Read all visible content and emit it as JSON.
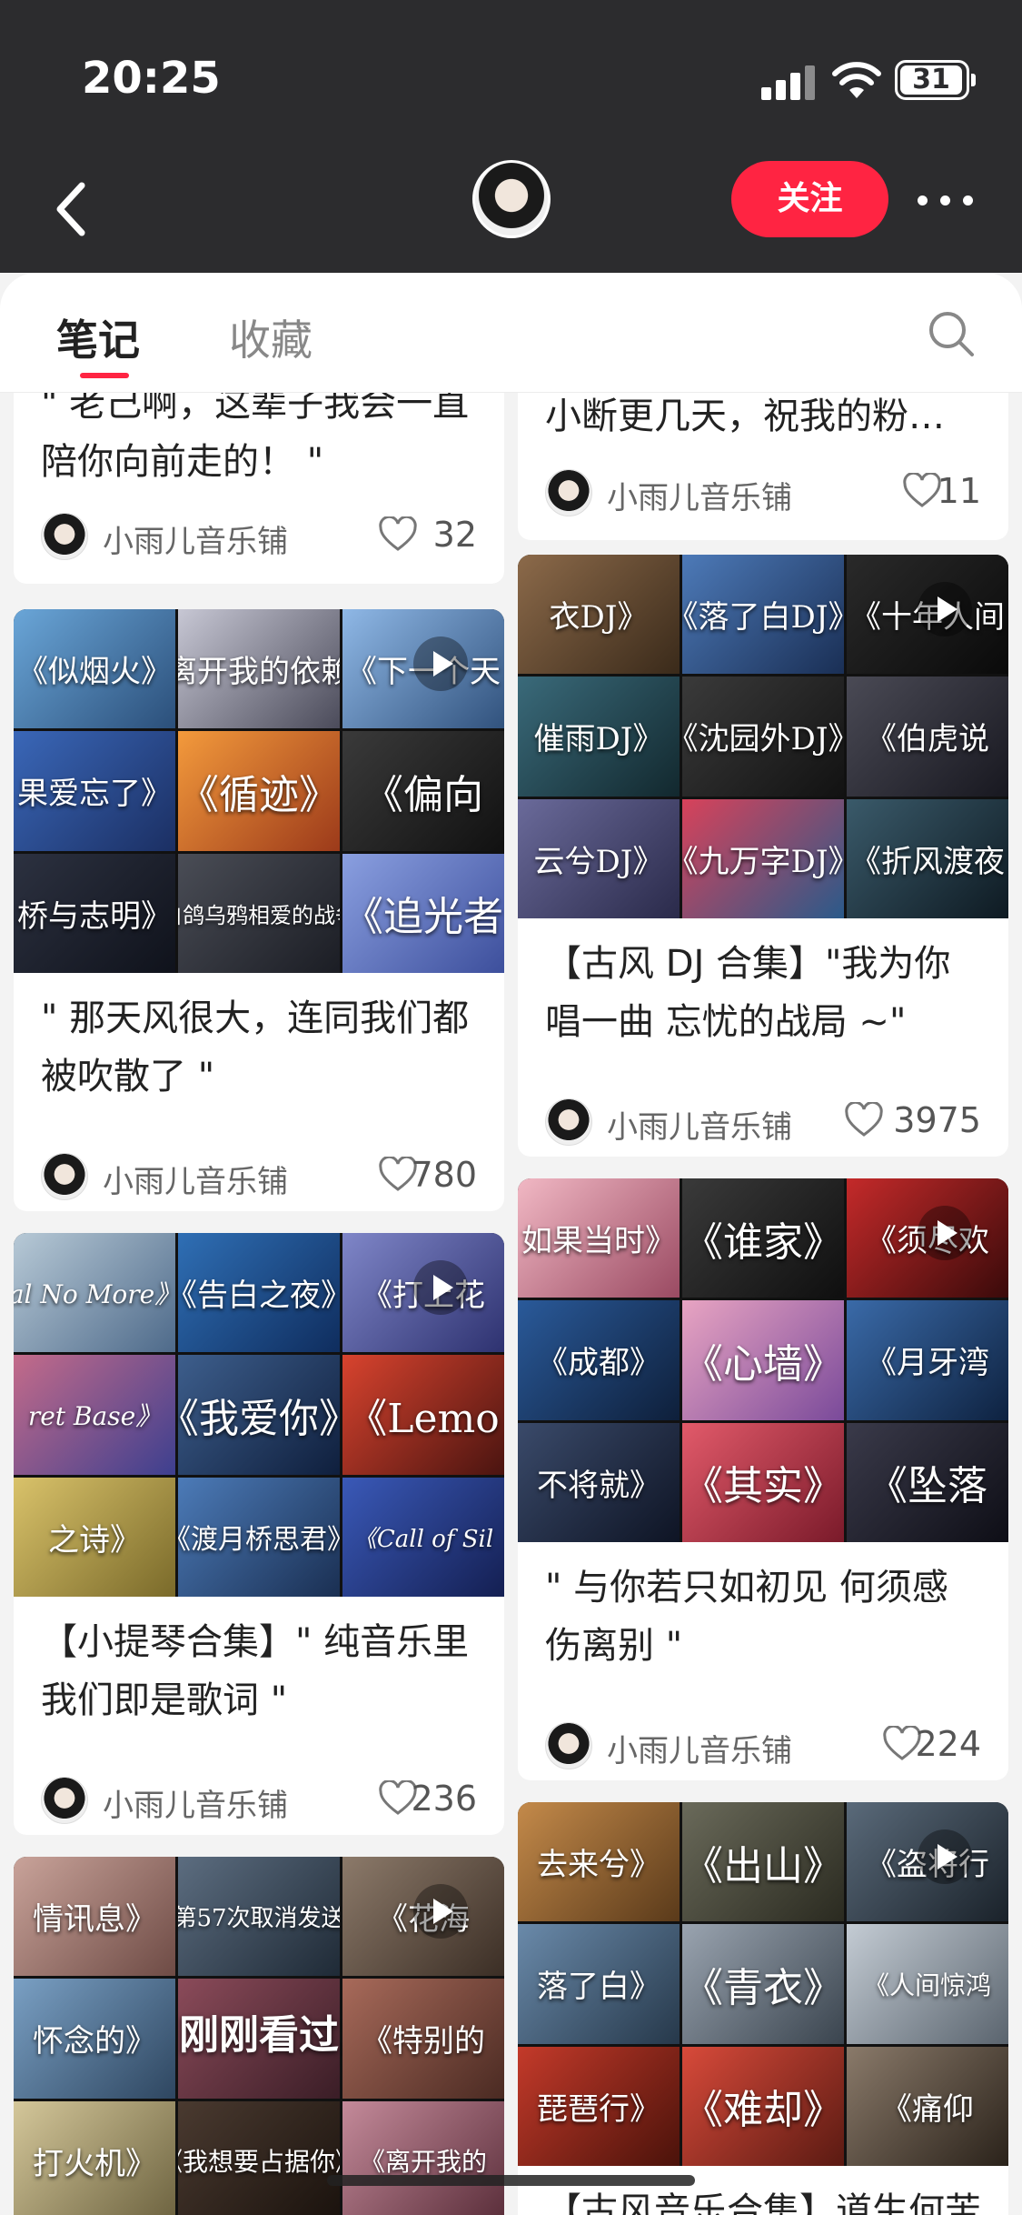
{
  "status_bar": {
    "time": "20:25",
    "battery": "31"
  },
  "nav": {
    "follow_label": "关注",
    "back_icon": "chevron-left-icon",
    "more_icon": "more-horizontal-icon"
  },
  "tabs": {
    "notes": "笔记",
    "favorites": "收藏",
    "search_icon": "search-icon"
  },
  "accent_color": "#ff2442",
  "left_column": [
    {
      "title": "\" 老己啊，这辈子我会一直陪你向前走的！ \"",
      "author": "小雨儿音乐铺",
      "likes": "32"
    },
    {
      "cover": [
        "《似烟火》",
        "《离开我的依赖》",
        "《下一个天",
        "果爱忘了》",
        "《循迹》",
        "《偏向",
        "桥与志明》",
        "《白鸽乌鸦相爱的战争》",
        "《追光者"
      ],
      "title": "\" 那天风很大，连同我们都被吹散了 \"",
      "author": "小雨儿音乐铺",
      "likes": "780"
    },
    {
      "cover": [
        "al No More》",
        "《告白之夜》",
        "《打上花",
        "ret Base》",
        "《我爱你》",
        "《Lemo",
        "之诗》",
        "《渡月桥思君》",
        "《Call of Sil"
      ],
      "title": "【小提琴合集】\" 纯音乐里我们即是歌词 \"",
      "author": "小雨儿音乐铺",
      "likes": "236"
    },
    {
      "cover": [
        "情讯息》",
        "《第57次取消发送》",
        "《花海",
        "怀念的》",
        "",
        "《特别的",
        "打火机》",
        "《我想要占据你》",
        "《离开我的"
      ],
      "overlay": "刚刚看过"
    }
  ],
  "right_column": [
    {
      "title": "小断更几天，祝我的粉…",
      "author": "小雨儿音乐铺",
      "likes": "11"
    },
    {
      "cover": [
        "衣DJ》",
        "《落了白DJ》",
        "《十年人间",
        "催雨DJ》",
        "《沈园外DJ》",
        "《伯虎说",
        "云兮DJ》",
        "《九万字DJ》",
        "《折风渡夜"
      ],
      "title": "【古风 DJ 合集】\"我为你唱一曲 忘忧的战局 ~\"",
      "author": "小雨儿音乐铺",
      "likes": "3975"
    },
    {
      "cover": [
        "如果当时》",
        "《谁家》",
        "《须尽欢",
        "《成都》",
        "《心墙》",
        "《月牙湾",
        "不将就》",
        "《其实》",
        "《坠落"
      ],
      "title": "\" 与你若只如初见 何须感伤离别 \"",
      "author": "小雨儿音乐铺",
      "likes": "224"
    },
    {
      "cover": [
        "去来兮》",
        "《出山》",
        "《盗将行",
        "落了白》",
        "《青衣》",
        "《人间惊鸿",
        "琵琶行》",
        "《难却》",
        "《痛仰"
      ],
      "title": "【古风音乐合集】道生何苦"
    }
  ]
}
